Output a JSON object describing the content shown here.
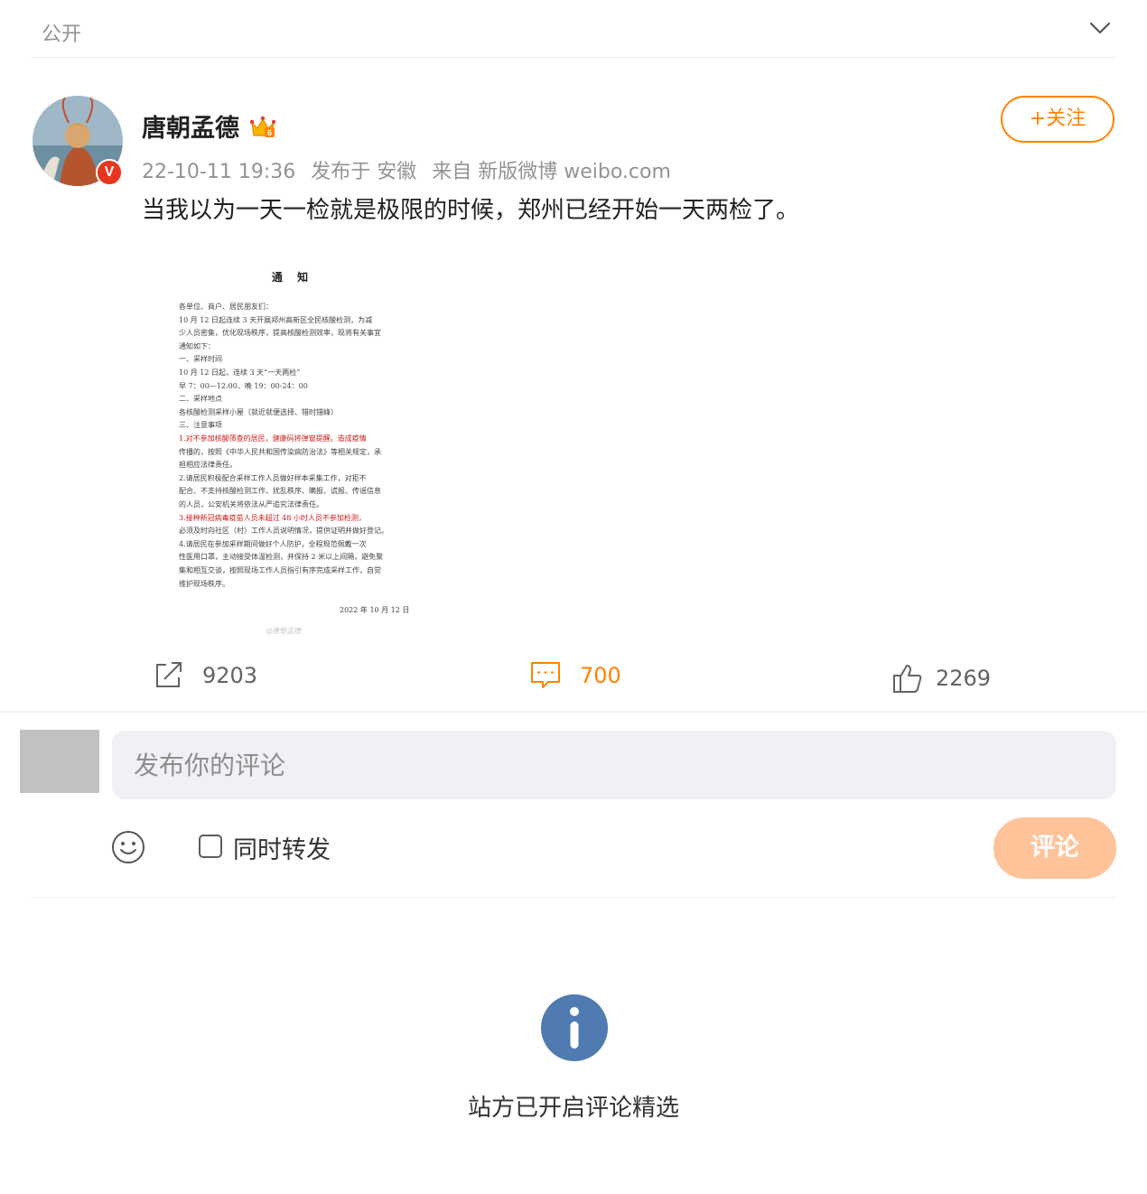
{
  "visibility": {
    "label": "公开",
    "chevron_icon": "chevron-down-icon"
  },
  "post": {
    "author": {
      "name": "唐朝孟德",
      "verified_badge": "V",
      "vip_icon": "vip-crown-icon"
    },
    "meta": {
      "time": "22-10-11 19:36",
      "location": "发布于 安徽",
      "source": "来自 新版微博 weibo.com"
    },
    "follow_label": "+关注",
    "text": "当我以为一天一检就是极限的时候，郑州已经开始一天两检了。",
    "image": {
      "title": "通 知",
      "lines": [
        "各单位、商户、居民朋友们：",
        "    10 月 12 日起连续 3 天开展郑州高新区全民核酸检测，为减",
        "少人员密集，优化现场秩序，提高核酸检测效率，现将有关事宜",
        "通知如下：",
        "    一、采样时间",
        "    10 月 12 日起，连续 3 天“一天两检”",
        "    早 7：00—12:00、晚 19：00-24：00",
        "    二、采样地点",
        "    各核酸检测采样小屋（就近就便选择、错时错峰）",
        "    三、注意事项",
        "    1.对不参加核酸筛查的居民，健康码将弹窗提醒。造成疫情",
        "传播的，按照《中华人民共和国传染病防治法》等相关规定，承",
        "担相应法律责任。",
        "    2.请居民积极配合采样工作人员做好样本采集工作，对拒不",
        "配合、不支持核酸检测工作、扰乱秩序、瞒报、谎报、传谣信息",
        "的人员，公安机关将依法从严追究法律责任。",
        "    3.接种新冠病毒疫苗人员未超过 48 小时人员不参加检测，",
        "必须及时向社区（村）工作人员说明情况，提供证明并做好登记。",
        "    4.请居民在参加采样期间做好个人防护，全程规范佩戴一次",
        "性医用口罩，主动接受体温检测，并保持 2 米以上间隔，避免聚",
        "集和相互交谈，按照现场工作人员指引有序完成采样工作，自觉",
        "维护现场秩序。"
      ],
      "date": "2022 年 10 月 12 日",
      "watermark": "@唐朝孟德"
    },
    "actions": {
      "repost_count": "9203",
      "comment_count": "700",
      "like_count": "2269"
    }
  },
  "composer": {
    "placeholder": "发布你的评论",
    "repost_label": "同时转发",
    "submit_label": "评论"
  },
  "notice": {
    "text": "站方已开启评论精选"
  },
  "colors": {
    "accent": "#ff8200",
    "info": "#4f7bb0",
    "submit_disabled": "#ffc39a"
  }
}
